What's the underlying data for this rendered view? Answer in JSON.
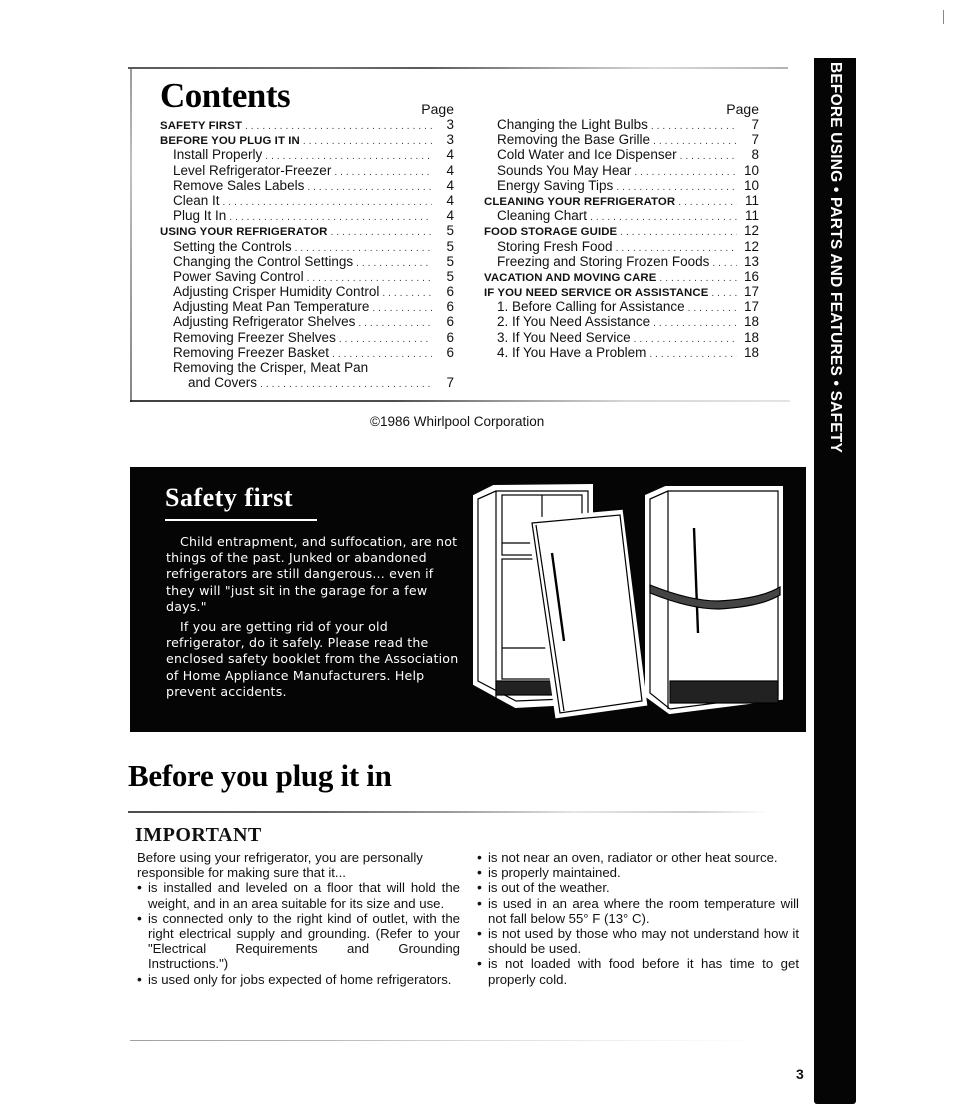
{
  "side_tab": {
    "text": "BEFORE USING • PARTS AND FEATURES • SAFETY"
  },
  "contents": {
    "title": "Contents",
    "page_header": "Page",
    "left_column": [
      {
        "label": "SAFETY FIRST",
        "page": "3",
        "style": "bold"
      },
      {
        "label": "BEFORE YOU PLUG IT IN",
        "page": "3",
        "style": "bold"
      },
      {
        "label": "Install Properly",
        "page": "4",
        "style": "sub"
      },
      {
        "label": "Level Refrigerator-Freezer",
        "page": "4",
        "style": "sub"
      },
      {
        "label": "Remove Sales Labels",
        "page": "4",
        "style": "sub"
      },
      {
        "label": "Clean It",
        "page": "4",
        "style": "sub"
      },
      {
        "label": "Plug It In",
        "page": "4",
        "style": "sub"
      },
      {
        "label": "USING YOUR REFRIGERATOR",
        "page": "5",
        "style": "bold"
      },
      {
        "label": "Setting the Controls",
        "page": "5",
        "style": "sub"
      },
      {
        "label": "Changing the Control Settings",
        "page": "5",
        "style": "sub"
      },
      {
        "label": "Power Saving Control",
        "page": "5",
        "style": "sub"
      },
      {
        "label": "Adjusting Crisper Humidity Control",
        "page": "6",
        "style": "sub"
      },
      {
        "label": "Adjusting Meat Pan Temperature",
        "page": "6",
        "style": "sub"
      },
      {
        "label": "Adjusting Refrigerator Shelves",
        "page": "6",
        "style": "sub"
      },
      {
        "label": "Removing Freezer Shelves",
        "page": "6",
        "style": "sub"
      },
      {
        "label": "Removing Freezer Basket",
        "page": "6",
        "style": "sub"
      },
      {
        "label": "Removing the Crisper, Meat Pan",
        "page": "",
        "style": "sub"
      },
      {
        "label": "and Covers",
        "page": "7",
        "style": "sub2"
      }
    ],
    "right_column": [
      {
        "label": "Changing the Light Bulbs",
        "page": "7",
        "style": "sub"
      },
      {
        "label": "Removing the Base Grille",
        "page": "7",
        "style": "sub"
      },
      {
        "label": "Cold Water and Ice Dispenser",
        "page": "8",
        "style": "sub"
      },
      {
        "label": "Sounds You May Hear",
        "page": "10",
        "style": "sub"
      },
      {
        "label": "Energy Saving Tips",
        "page": "10",
        "style": "sub"
      },
      {
        "label": "CLEANING YOUR REFRIGERATOR",
        "page": "11",
        "style": "bold"
      },
      {
        "label": "Cleaning Chart",
        "page": "11",
        "style": "sub"
      },
      {
        "label": "FOOD STORAGE GUIDE",
        "page": "12",
        "style": "bold"
      },
      {
        "label": "Storing Fresh Food",
        "page": "12",
        "style": "sub"
      },
      {
        "label": "Freezing and Storing Frozen Foods",
        "page": "13",
        "style": "sub"
      },
      {
        "label": "VACATION AND MOVING CARE",
        "page": "16",
        "style": "bold"
      },
      {
        "label": "IF YOU NEED SERVICE OR ASSISTANCE",
        "page": "17",
        "style": "bold"
      },
      {
        "label": "1. Before Calling for Assistance",
        "page": "17",
        "style": "sub"
      },
      {
        "label": "2. If You Need Assistance",
        "page": "18",
        "style": "sub"
      },
      {
        "label": "3. If You Need Service",
        "page": "18",
        "style": "sub"
      },
      {
        "label": "4. If You Have a Problem",
        "page": "18",
        "style": "sub"
      }
    ]
  },
  "copyright": "©1986 Whirlpool Corporation",
  "safety_first": {
    "title": "Safety first",
    "paragraphs": [
      "Child entrapment, and suffocation, are not things of the past. Junked or abandoned refrigerators are still dangerous... even if they will \"just sit in the garage for a few days.\"",
      "If you are getting rid of your old refrigerator, do it safely. Please read the enclosed safety booklet from the Association of Home Appliance Manufacturers. Help prevent accidents."
    ],
    "illustration": "refrigerators-door-removed-and-tied-shut"
  },
  "before_you_plug": {
    "title": "Before you plug it in",
    "subheading": "IMPORTANT",
    "intro": "Before using your refrigerator, you are personally responsible for making sure that it...",
    "left_bullets": [
      "is installed and leveled on a floor that will hold the weight, and in an area suitable for its size and use.",
      "is connected only to the right kind of outlet, with the right electrical supply and grounding. (Refer to your \"Electrical Requirements and Grounding Instructions.\")",
      "is used only for jobs expected of home refrigerators."
    ],
    "right_bullets": [
      "is not near an oven, radiator or other heat source.",
      "is properly maintained.",
      "is out of the weather.",
      "is used in an area where the room temperature will not fall below 55° F (13° C).",
      "is not used by those who may not understand how it should be used.",
      "is not loaded with food before it has time to get properly cold."
    ]
  },
  "page_number": "3"
}
